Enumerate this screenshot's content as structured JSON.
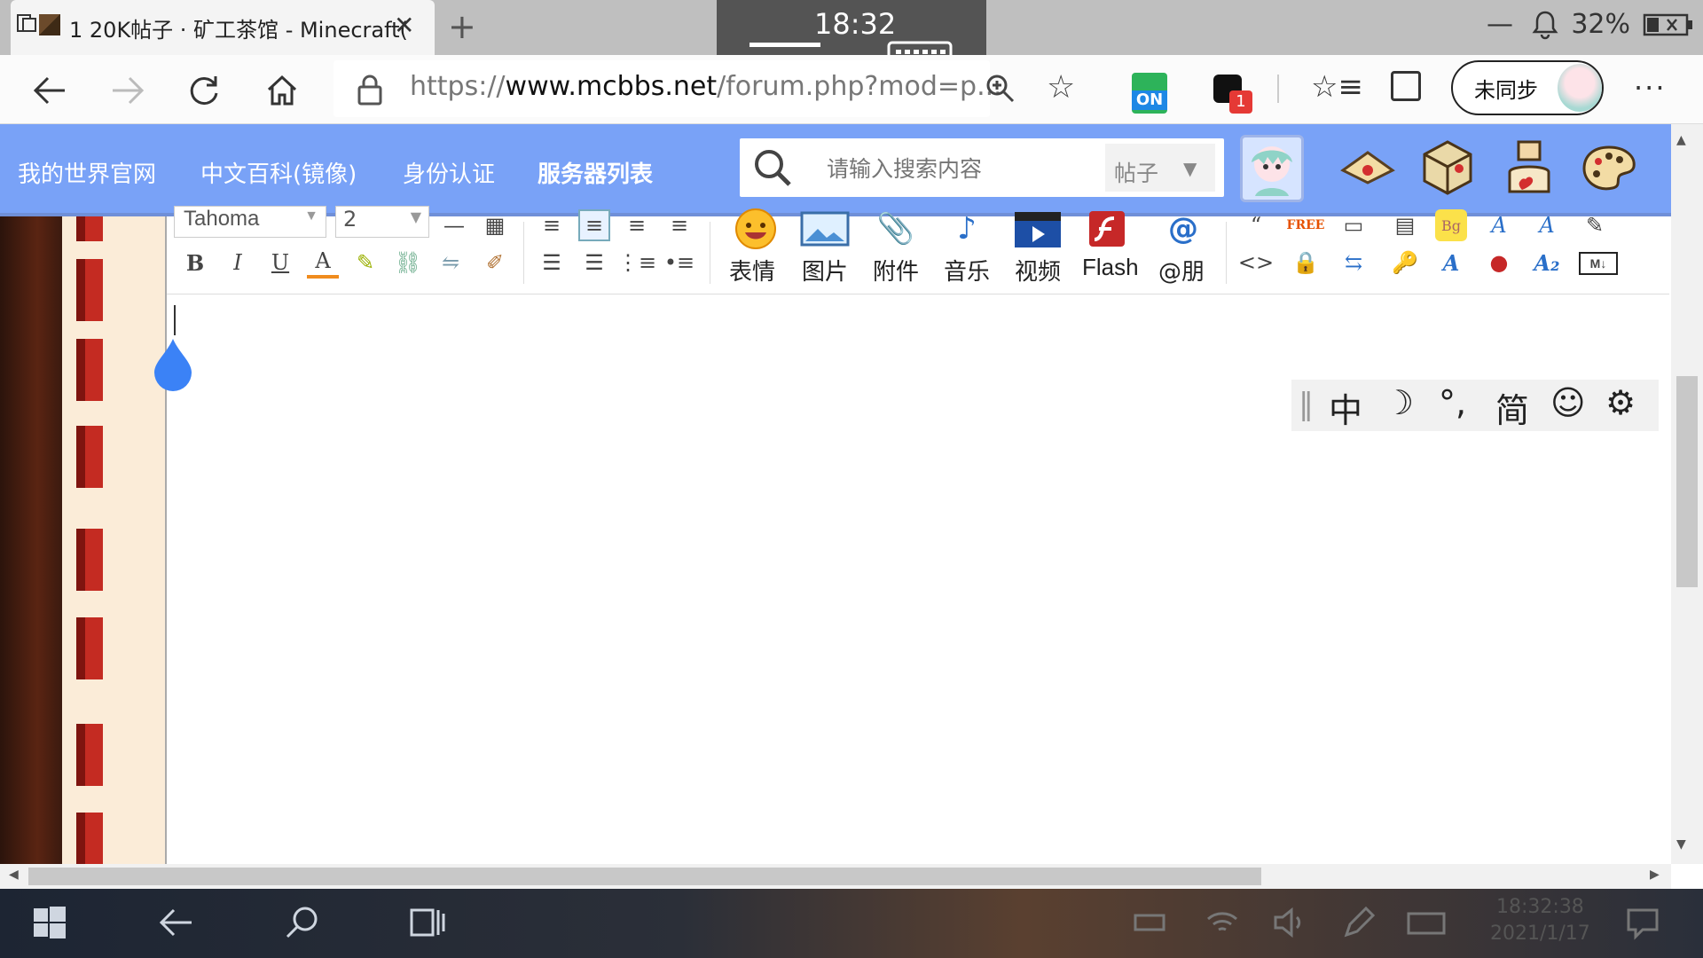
{
  "browser": {
    "tab": {
      "title": "1 20K帖子 · 矿工茶馆 - Minecraft(",
      "close": "✕"
    },
    "new_tab": "+",
    "clock": "18:32",
    "battery": "32%",
    "url": {
      "prefix": "https://",
      "domain": "www.mcbbs.net",
      "path": "/forum.php?mod=p..."
    },
    "extension_on_label": "ON",
    "extension_badge_count": "1",
    "sync_label": "未同步",
    "more": "···"
  },
  "site": {
    "nav": [
      "我的世界官网",
      "中文百科(镜像)",
      "身份认证",
      "服务器列表"
    ],
    "search": {
      "placeholder": "请输入搜索内容",
      "type": "帖子",
      "type_arrow": "▼"
    }
  },
  "editor": {
    "font": "Tahoma",
    "size": "2",
    "format_buttons": [
      "B",
      "I",
      "U",
      "A"
    ],
    "insert_buttons": [
      "表情",
      "图片",
      "附件",
      "音乐",
      "视频",
      "Flash",
      "@朋"
    ]
  },
  "ime": {
    "items": [
      "中",
      "☽",
      "°,",
      "简",
      "☺",
      "⚙"
    ]
  },
  "taskbar": {
    "time": "18:32:38",
    "date": "2021/1/17"
  },
  "colors": {
    "header": "#79a2f7",
    "accent": "#1e6fe8"
  }
}
